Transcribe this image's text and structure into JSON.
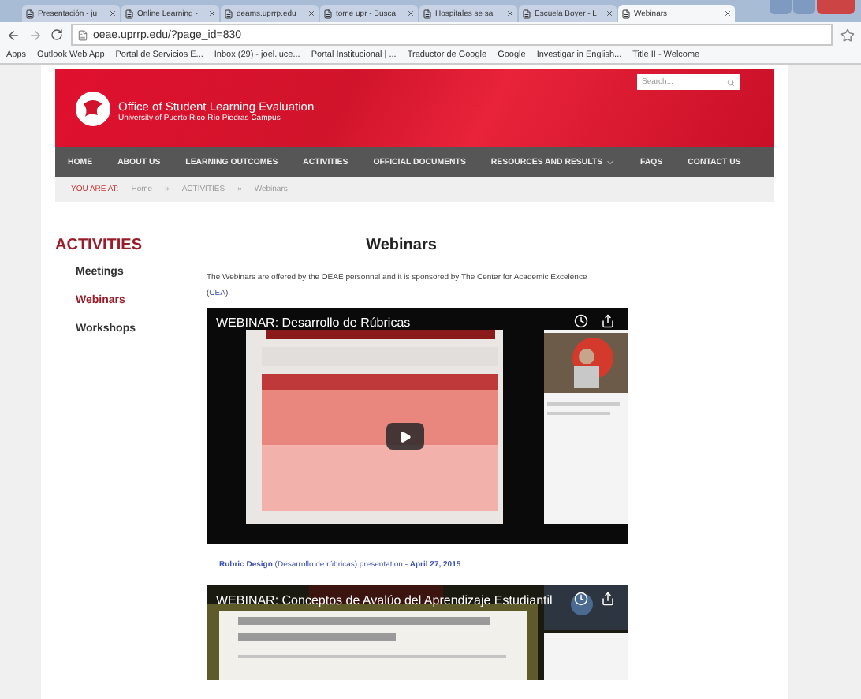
{
  "browser": {
    "tabs": [
      {
        "label": "Presentación - ju",
        "selected": false
      },
      {
        "label": "Online Learning -",
        "selected": false
      },
      {
        "label": "deams.uprrp.edu",
        "selected": false
      },
      {
        "label": "tome upr - Busca",
        "selected": false
      },
      {
        "label": "Hospitales se sa",
        "selected": false
      },
      {
        "label": "Escuela Boyer - L",
        "selected": false
      },
      {
        "label": "Webinars",
        "selected": true
      }
    ],
    "url": "oeae.uprrp.edu/?page_id=830",
    "bookmarks": [
      "Apps",
      "Outlook Web App",
      "Portal de Servicios E...",
      "Inbox (29) - joel.luce...",
      "Portal Institucional | ...",
      "Traductor de Google",
      "Google",
      "Investigar in English...",
      "Title II - Welcome"
    ]
  },
  "site": {
    "title": "Office of Student Learning Evaluation",
    "subtitle": "University of Puerto Rico-Río Piedras Campus",
    "search": {
      "placeholder": "Search..."
    },
    "nav": [
      {
        "label": "HOME",
        "dropdown": false
      },
      {
        "label": "ABOUT US",
        "dropdown": false
      },
      {
        "label": "LEARNING OUTCOMES",
        "dropdown": false
      },
      {
        "label": "ACTIVITIES",
        "dropdown": false
      },
      {
        "label": "OFFICIAL DOCUMENTS",
        "dropdown": false
      },
      {
        "label": "RESOURCES AND RESULTS",
        "dropdown": true
      },
      {
        "label": "FAQS",
        "dropdown": false
      },
      {
        "label": "CONTACT US",
        "dropdown": false
      }
    ],
    "breadcrumb": {
      "prefix": "YOU ARE AT:",
      "separator": "»",
      "items": [
        "Home",
        "ACTIVITIES",
        "Webinars"
      ]
    }
  },
  "sidebar": {
    "heading": "ACTIVITIES",
    "items": [
      {
        "label": "Meetings",
        "selected": false
      },
      {
        "label": "Webinars",
        "selected": true
      },
      {
        "label": "Workshops",
        "selected": false
      }
    ]
  },
  "main": {
    "title": "Webinars",
    "intro": {
      "text": "The Webinars are offered by the OEAE personnel and it is sponsored by The Center for Academic Excelence (",
      "link": "CEA",
      "after": ")."
    },
    "videos": [
      {
        "title": "WEBINAR: Desarrollo de Rúbricas",
        "caption": "**Rubric Design** (Desarrollo de rúbricas) presentation - **April 27, 2015**"
      },
      {
        "title": "WEBINAR: Conceptos de Avalúo del Aprendizaje Estudiantil"
      }
    ]
  }
}
